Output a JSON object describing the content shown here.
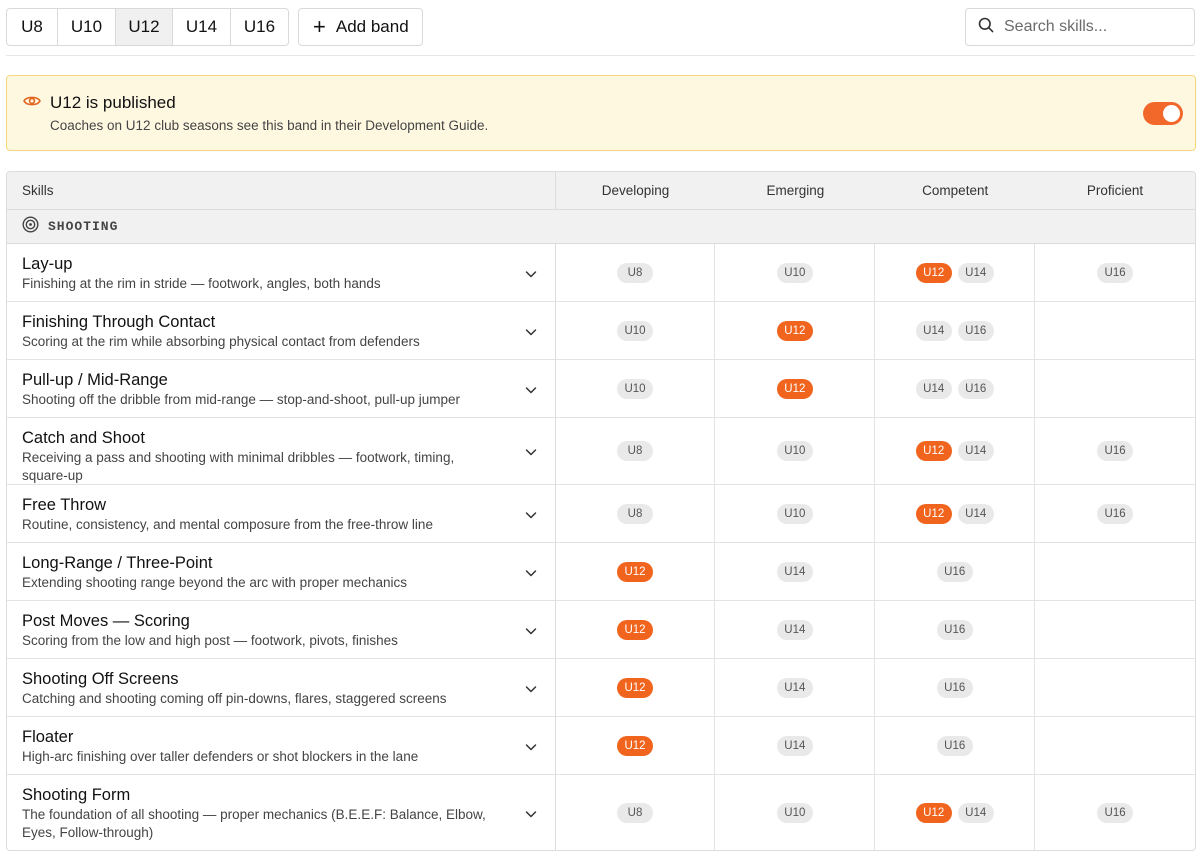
{
  "band_tabs": [
    {
      "label": "U8",
      "active": false
    },
    {
      "label": "U10",
      "active": false
    },
    {
      "label": "U12",
      "active": true
    },
    {
      "label": "U14",
      "active": false
    },
    {
      "label": "U16",
      "active": false
    }
  ],
  "add_band_label": "Add band",
  "search": {
    "placeholder": "Search skills..."
  },
  "banner": {
    "title": "U12 is published",
    "subtitle": "Coaches on U12 club seasons see this band in their Development Guide.",
    "published": true,
    "icon": "eye-icon"
  },
  "table": {
    "headers": {
      "skills": "Skills",
      "levels": [
        "Developing",
        "Emerging",
        "Competent",
        "Proficient"
      ]
    },
    "current_band": "U12",
    "category": {
      "label": "SHOOTING",
      "icon": "target-icon"
    },
    "rows": [
      {
        "name": "Lay-up",
        "desc": "Finishing at the rim in stride — footwork, angles, both hands",
        "levels": [
          [
            "U8"
          ],
          [
            "U10"
          ],
          [
            "U12",
            "U14"
          ],
          [
            "U16"
          ]
        ]
      },
      {
        "name": "Finishing Through Contact",
        "desc": "Scoring at the rim while absorbing physical contact from defenders",
        "levels": [
          [
            "U10"
          ],
          [
            "U12"
          ],
          [
            "U14",
            "U16"
          ],
          []
        ]
      },
      {
        "name": "Pull-up / Mid-Range",
        "desc": "Shooting off the dribble from mid-range — stop-and-shoot, pull-up jumper",
        "levels": [
          [
            "U10"
          ],
          [
            "U12"
          ],
          [
            "U14",
            "U16"
          ],
          []
        ]
      },
      {
        "name": "Catch and Shoot",
        "desc": "Receiving a pass and shooting with minimal dribbles — footwork, timing, square-up",
        "levels": [
          [
            "U8"
          ],
          [
            "U10"
          ],
          [
            "U12",
            "U14"
          ],
          [
            "U16"
          ]
        ]
      },
      {
        "name": "Free Throw",
        "desc": "Routine, consistency, and mental composure from the free-throw line",
        "levels": [
          [
            "U8"
          ],
          [
            "U10"
          ],
          [
            "U12",
            "U14"
          ],
          [
            "U16"
          ]
        ]
      },
      {
        "name": "Long-Range / Three-Point",
        "desc": "Extending shooting range beyond the arc with proper mechanics",
        "levels": [
          [
            "U12"
          ],
          [
            "U14"
          ],
          [
            "U16"
          ],
          []
        ]
      },
      {
        "name": "Post Moves — Scoring",
        "desc": "Scoring from the low and high post — footwork, pivots, finishes",
        "levels": [
          [
            "U12"
          ],
          [
            "U14"
          ],
          [
            "U16"
          ],
          []
        ]
      },
      {
        "name": "Shooting Off Screens",
        "desc": "Catching and shooting coming off pin-downs, flares, staggered screens",
        "levels": [
          [
            "U12"
          ],
          [
            "U14"
          ],
          [
            "U16"
          ],
          []
        ]
      },
      {
        "name": "Floater",
        "desc": "High-arc finishing over taller defenders or shot blockers in the lane",
        "levels": [
          [
            "U12"
          ],
          [
            "U14"
          ],
          [
            "U16"
          ],
          []
        ]
      },
      {
        "name": "Shooting Form",
        "desc": "The foundation of all shooting — proper mechanics (B.E.E.F: Balance, Elbow, Eyes, Follow-through)",
        "levels": [
          [
            "U8"
          ],
          [
            "U10"
          ],
          [
            "U12",
            "U14"
          ],
          [
            "U16"
          ]
        ]
      }
    ]
  },
  "colors": {
    "accent": "#f0641e",
    "banner_bg": "#fff8e1",
    "banner_border": "#f4d879",
    "chip_bg": "#e9e9e9"
  }
}
